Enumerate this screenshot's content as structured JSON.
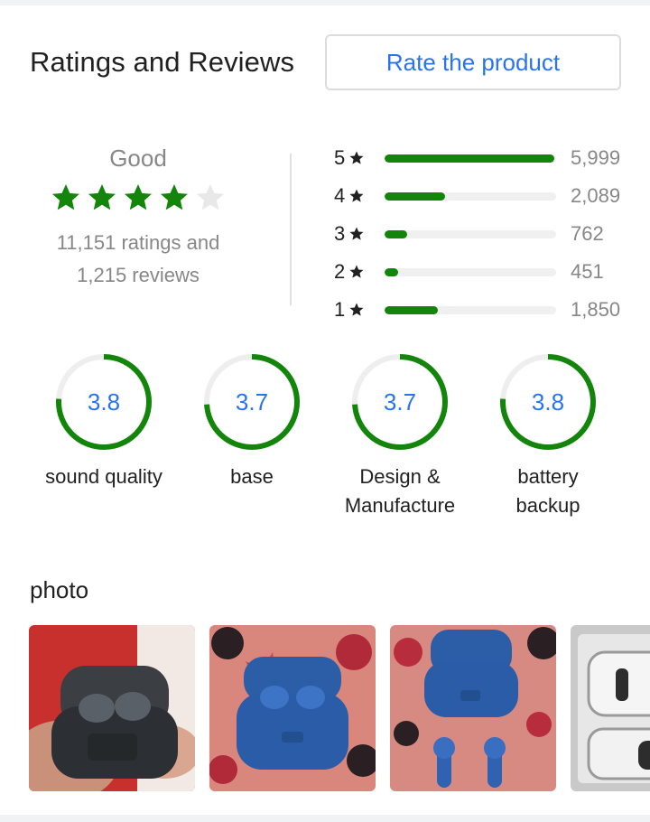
{
  "header": {
    "title": "Ratings and Reviews",
    "rate_button": "Rate the product"
  },
  "summary": {
    "verdict": "Good",
    "stars_filled": 4,
    "stars_total": 5,
    "ratings_line": "11,151 ratings and",
    "reviews_line": "1,215 reviews",
    "star_color": "#13850a",
    "empty_star_color": "#e8e8e8"
  },
  "breakdown": [
    {
      "label": "5",
      "count": "5,999",
      "fraction": 0.99
    },
    {
      "label": "4",
      "count": "2,089",
      "fraction": 0.35
    },
    {
      "label": "3",
      "count": "762",
      "fraction": 0.13
    },
    {
      "label": "2",
      "count": "451",
      "fraction": 0.08
    },
    {
      "label": "1",
      "count": "1,850",
      "fraction": 0.31
    }
  ],
  "aspects": [
    {
      "value": "3.8",
      "label_1": "sound quality",
      "label_2": "",
      "fraction": 0.76
    },
    {
      "value": "3.7",
      "label_1": "base",
      "label_2": "",
      "fraction": 0.74
    },
    {
      "value": "3.7",
      "label_1": "Design &",
      "label_2": "Manufacture",
      "fraction": 0.74
    },
    {
      "value": "3.8",
      "label_1": "battery",
      "label_2": "backup",
      "fraction": 0.76
    }
  ],
  "photos": {
    "title": "photo",
    "items": [
      {
        "name": "photo-black-earbuds-case"
      },
      {
        "name": "photo-blue-earbuds-case"
      },
      {
        "name": "photo-blue-case-and-earbuds"
      },
      {
        "name": "photo-white-packaging"
      }
    ]
  },
  "colors": {
    "accent": "#2874f0",
    "green": "#13850a",
    "muted": "#878787"
  }
}
